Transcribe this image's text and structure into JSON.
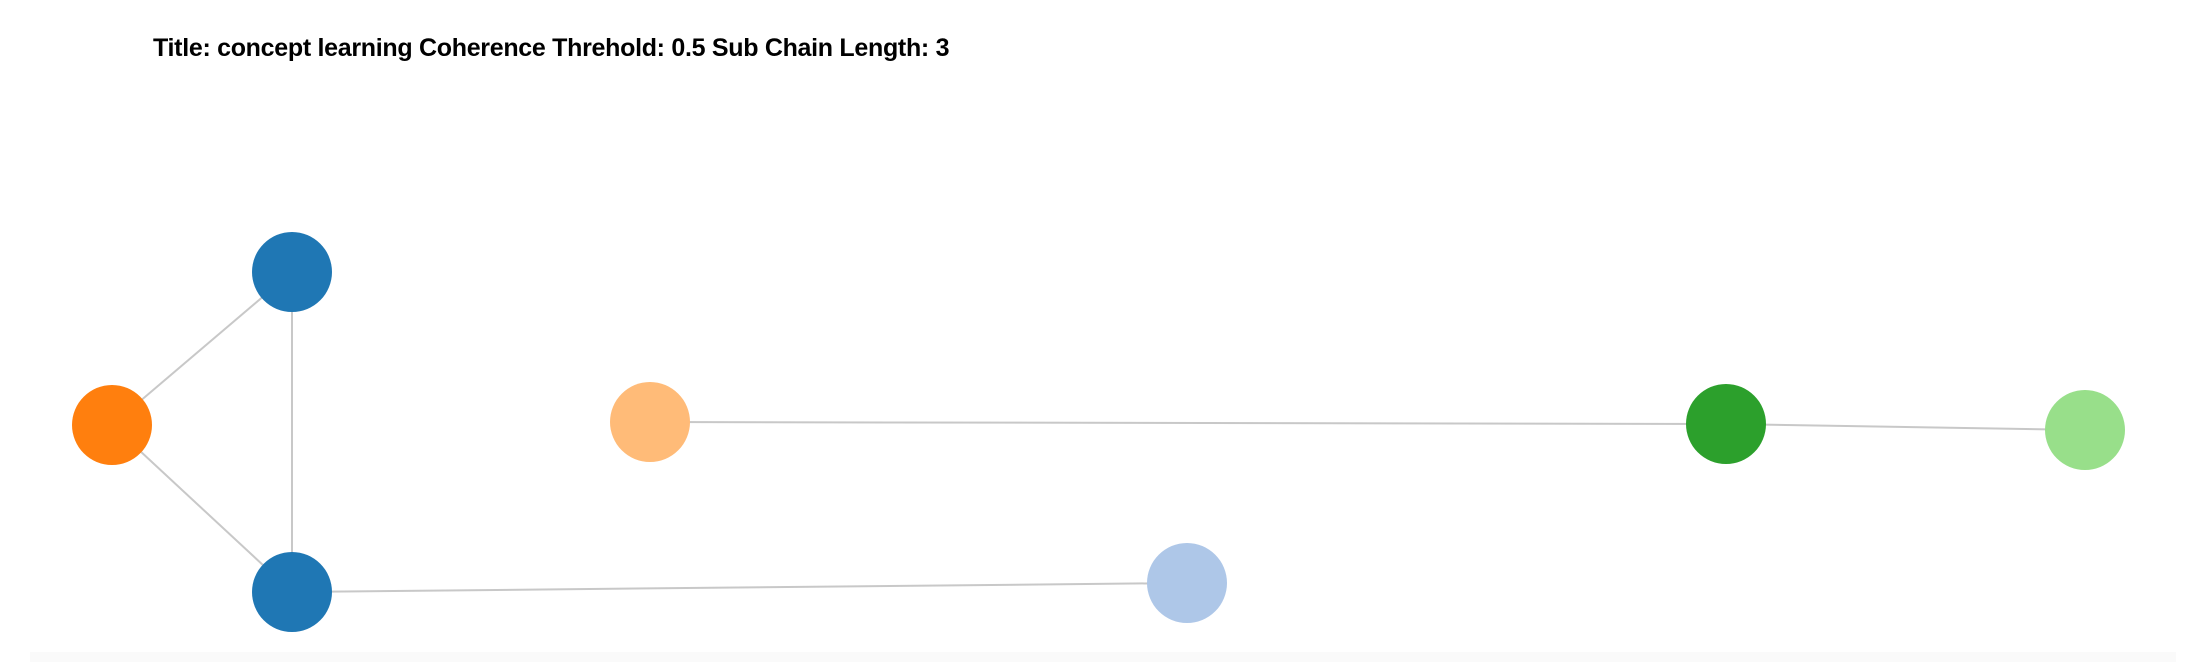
{
  "header": {
    "title": "Title: concept learning Coherence Threhold: 0.5 Sub Chain Length: 3"
  },
  "graph": {
    "edge_color": "#c8c8c8",
    "nodes": [
      {
        "id": "n1",
        "color": "#1f77b4"
      },
      {
        "id": "n2",
        "color": "#ff7f0e"
      },
      {
        "id": "n3",
        "color": "#1f77b4"
      },
      {
        "id": "n4",
        "color": "#aec7e8"
      },
      {
        "id": "n5",
        "color": "#ffbb78"
      },
      {
        "id": "n6",
        "color": "#2ca02c"
      },
      {
        "id": "n7",
        "color": "#98df8a"
      }
    ],
    "edges": [
      {
        "source": "n1",
        "target": "n2"
      },
      {
        "source": "n1",
        "target": "n3"
      },
      {
        "source": "n2",
        "target": "n3"
      },
      {
        "source": "n3",
        "target": "n4"
      },
      {
        "source": "n5",
        "target": "n6"
      },
      {
        "source": "n6",
        "target": "n7"
      }
    ]
  }
}
